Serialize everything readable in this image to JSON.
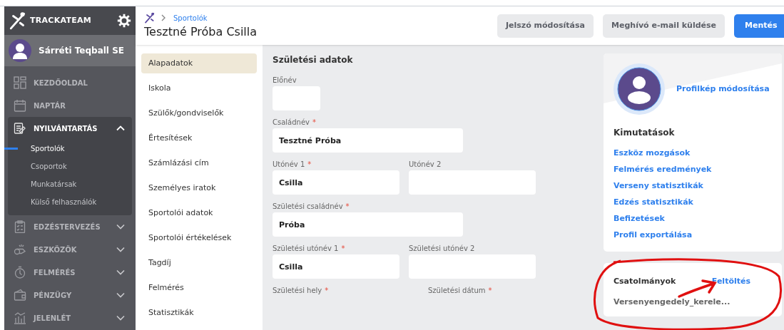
{
  "sidebar": {
    "brand": "TRACKATEAM",
    "club": "Sárréti Teqball SE",
    "items": [
      {
        "label": "KEZDŐOLDAL",
        "kind": "link"
      },
      {
        "label": "NAPTÁR",
        "kind": "link"
      },
      {
        "label": "NYILVÁNTARTÁS",
        "kind": "group",
        "expanded": true,
        "children": [
          {
            "label": "Sportolók",
            "selected": true
          },
          {
            "label": "Csoportok",
            "selected": false
          },
          {
            "label": "Munkatársak",
            "selected": false
          },
          {
            "label": "Külső felhasználók",
            "selected": false
          }
        ]
      },
      {
        "label": "EDZÉSTERVEZÉS",
        "kind": "group",
        "expanded": false
      },
      {
        "label": "ESZKÖZÖK",
        "kind": "group",
        "expanded": false
      },
      {
        "label": "FELMÉRÉS",
        "kind": "group",
        "expanded": false
      },
      {
        "label": "PÉNZÜGY",
        "kind": "group",
        "expanded": false
      },
      {
        "label": "JELENLÉT",
        "kind": "group",
        "expanded": false
      }
    ]
  },
  "header": {
    "breadcrumb": "Sportolók",
    "title": "Tesztné Próba Csilla",
    "buttons": [
      {
        "label": "Jelszó módosítása",
        "kind": "secondary"
      },
      {
        "label": "Meghívó e-mail küldése",
        "kind": "secondary"
      },
      {
        "label": "Mentés",
        "kind": "primary"
      }
    ]
  },
  "subnav": [
    {
      "label": "Alapadatok",
      "selected": true
    },
    {
      "label": "Iskola",
      "selected": false
    },
    {
      "label": "Szülők/gondviselők",
      "selected": false
    },
    {
      "label": "Értesítések",
      "selected": false
    },
    {
      "label": "Számlázási cím",
      "selected": false
    },
    {
      "label": "Személyes iratok",
      "selected": false
    },
    {
      "label": "Sportolói adatok",
      "selected": false
    },
    {
      "label": "Sportolói értékelések",
      "selected": false
    },
    {
      "label": "Tagdíj",
      "selected": false
    },
    {
      "label": "Felmérés",
      "selected": false
    },
    {
      "label": "Statisztikák",
      "selected": false
    }
  ],
  "form": {
    "title": "Születési adatok",
    "rows": [
      [
        {
          "label": "Előnév",
          "kind": "short"
        }
      ],
      [
        {
          "label": "Családnév",
          "required_mark": "*",
          "kind": "wide",
          "value": "Tesztné Próba"
        }
      ],
      [
        {
          "label": "Utónév 1",
          "required_mark": "*",
          "kind": "half",
          "value": "Csilla"
        },
        {
          "label": "Utónév 2",
          "kind": "half"
        }
      ],
      [
        {
          "label": "Születési családnév",
          "required_mark": "*",
          "kind": "wide",
          "value": "Próba"
        }
      ],
      [
        {
          "label": "Születési utónév 1",
          "required_mark": "*",
          "kind": "half",
          "value": "Csilla"
        },
        {
          "label": "Születési utónév 2",
          "kind": "half"
        }
      ],
      [
        {
          "label": "Születési hely",
          "required_mark": "*",
          "kind": "label"
        },
        {
          "label": "Születési dátum",
          "required_mark": "*",
          "kind": "label"
        }
      ]
    ]
  },
  "profile": {
    "change_picture": "Profilkép módosítása",
    "reports_title": "Kimutatások",
    "reports": [
      "Eszköz mozgások",
      "Felmérés eredmények",
      "Verseny statisztikák",
      "Edzés statisztikák",
      "Befizetések",
      "Profil exportálása"
    ]
  },
  "attachments": {
    "title": "Csatolmányok",
    "upload": "Feltöltés",
    "files": [
      "Versenyengedely_kerele..."
    ]
  }
}
